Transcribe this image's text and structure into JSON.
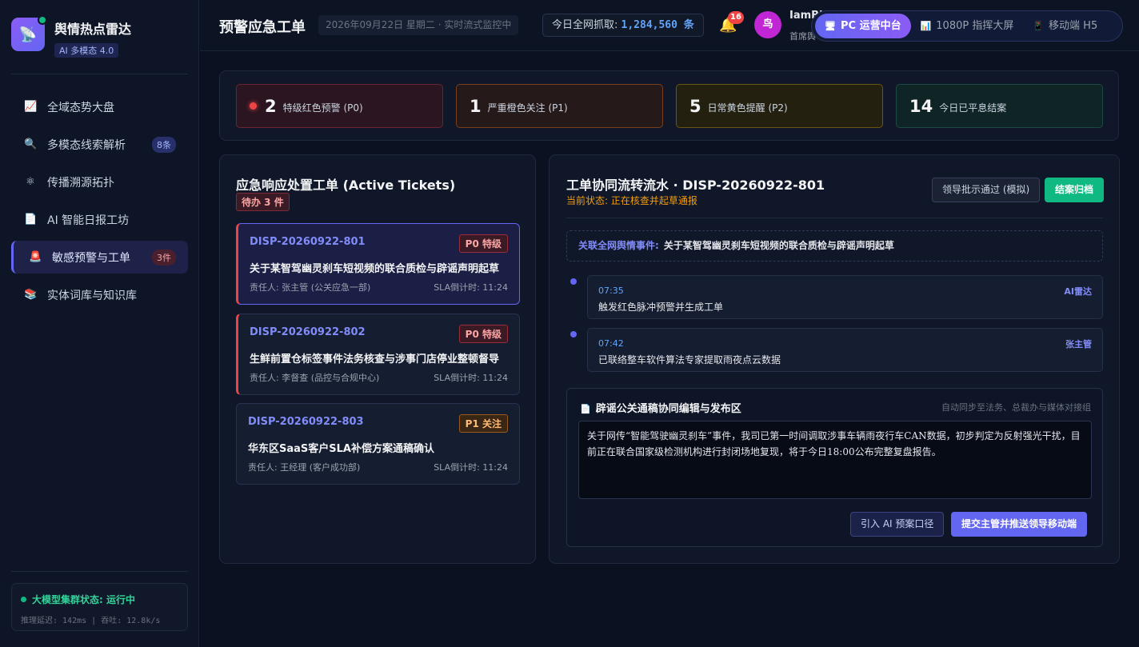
{
  "brand": {
    "title": "舆情热点雷达",
    "badge": "AI 多模态 4.0"
  },
  "nav": [
    {
      "icon": "📈",
      "label": "全域态势大盘",
      "badge": ""
    },
    {
      "icon": "🔍",
      "label": "多模态线索解析",
      "badge": "8条"
    },
    {
      "icon": "⚛",
      "label": "传播溯源拓扑",
      "badge": ""
    },
    {
      "icon": "📄",
      "label": "AI 智能日报工坊",
      "badge": ""
    },
    {
      "icon": "🚨",
      "label": "敏感预警与工单",
      "badge": "3件"
    },
    {
      "icon": "📚",
      "label": "实体词库与知识库",
      "badge": ""
    }
  ],
  "cluster": {
    "title": "大模型集群状态: 运行中",
    "meta": "推理延迟: 142ms | 吞吐: 12.8k/s"
  },
  "header": {
    "title": "预警应急工单",
    "date": "2026年09月22日 星期二 · 实时流式监控中",
    "crawl_label": "今日全网抓取: ",
    "crawl_value": "1,284,560 条",
    "bell_count": "16",
    "avatar": "鸟",
    "user_name": "IamBi",
    "user_role": "首席舆"
  },
  "view_switch": [
    {
      "icon": "🖥",
      "label": "PC 运营中台"
    },
    {
      "icon": "📊",
      "label": "1080P 指挥大屏"
    },
    {
      "icon": "📱",
      "label": "移动端 H5"
    }
  ],
  "stats": [
    {
      "num": "2",
      "label": "特级红色预警 (P0)",
      "color": "#f87171"
    },
    {
      "num": "1",
      "label": "严重橙色关注 (P1)",
      "color": "#f3f4f6"
    },
    {
      "num": "5",
      "label": "日常黄色提醒 (P2)",
      "color": "#f3f4f6"
    },
    {
      "num": "14",
      "label": "今日已平息结案",
      "color": "#f3f4f6"
    }
  ],
  "tickets_panel": {
    "title": "应急响应处置工单 (Active Tickets)",
    "pending": "待办 3 件",
    "items": [
      {
        "id": "DISP-20260922-801",
        "tag": "P0 特级",
        "title": "关于某智驾幽灵刹车短视频的联合质检与辟谣声明起草",
        "owner": "责任人: 张主管 (公关应急一部)",
        "sla": "SLA倒计时: 11:24"
      },
      {
        "id": "DISP-20260922-802",
        "tag": "P0 特级",
        "title": "生鲜前置仓标签事件法务核查与涉事门店停业整顿督导",
        "owner": "责任人: 李督查 (品控与合规中心)",
        "sla": "SLA倒计时: 11:24"
      },
      {
        "id": "DISP-20260922-803",
        "tag": "P1 关注",
        "title": "华东区SaaS客户SLA补偿方案通稿确认",
        "owner": "责任人: 王经理 (客户成功部)",
        "sla": "SLA倒计时: 11:24"
      }
    ]
  },
  "flow": {
    "title": "工单协同流转流水 · DISP-20260922-801",
    "status": "当前状态: 正在核查并起草通报",
    "approve_label": "领导批示通过 (模拟)",
    "archive_label": "结案归档",
    "linked_key": "关联全网舆情事件:",
    "linked_value": "关于某智驾幽灵刹车短视频的联合质检与辟谣声明起草",
    "timeline": [
      {
        "time": "07:35",
        "actor": "AI雷达",
        "text": "触发红色脉冲预警并生成工单"
      },
      {
        "time": "07:42",
        "actor": "张主管",
        "text": "已联络整车软件算法专家提取雨夜点云数据"
      }
    ],
    "editor": {
      "title": "辟谣公关通稿协同编辑与发布区",
      "sync": "自动同步至法务、总裁办与媒体对接组",
      "content": "关于网传“智能驾驶幽灵刹车”事件，我司已第一时间调取涉事车辆雨夜行车CAN数据，初步判定为反射强光干扰，目前正在联合国家级检测机构进行封闭场地复现，将于今日18:00公布完整复盘报告。",
      "ai_label": "引入 AI 预案口径",
      "push_label": "提交主管并推送领导移动端"
    }
  }
}
